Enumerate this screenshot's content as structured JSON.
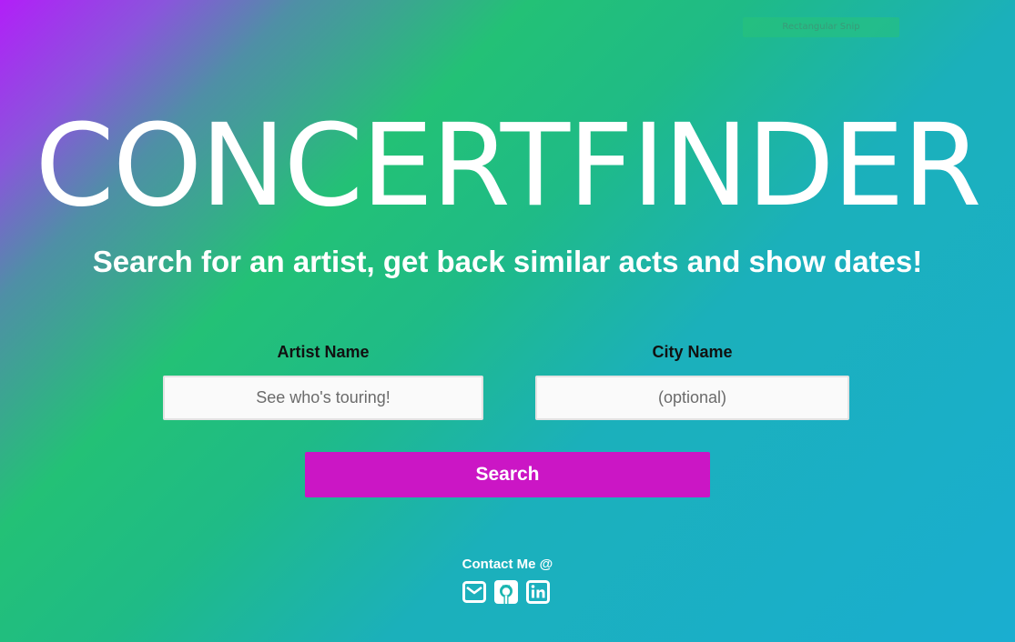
{
  "top_badge": {
    "label": "Rectangular Snip"
  },
  "header": {
    "title": "CONCERTFINDER",
    "subtitle": "Search for an artist, get back similar acts and show dates!"
  },
  "form": {
    "artist": {
      "label": "Artist Name",
      "placeholder": "See who's touring!",
      "value": ""
    },
    "city": {
      "label": "City Name",
      "placeholder": "(optional)",
      "value": ""
    },
    "search_label": "Search"
  },
  "footer": {
    "contact_label": "Contact Me @",
    "icons": [
      "envelope-icon",
      "github-icon",
      "linkedin-icon"
    ]
  },
  "colors": {
    "search_button": "#cb16c5",
    "gradient_start": "#b21ff8",
    "gradient_mid": "#23c176",
    "gradient_end": "#1aaed0"
  }
}
